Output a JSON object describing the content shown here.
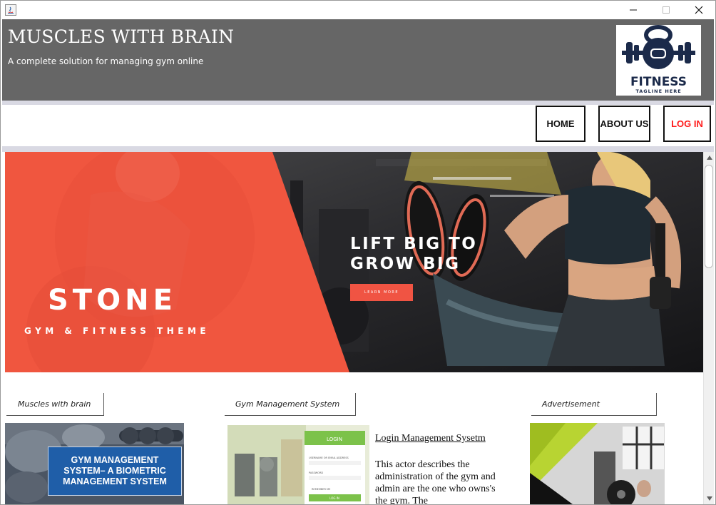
{
  "window": {
    "controls": {
      "minimize_icon": "minimize-icon",
      "maximize_icon": "maximize-icon",
      "close_icon": "close-icon"
    }
  },
  "header": {
    "title": "MUSCLES WITH BRAIN",
    "subtitle": "A complete solution for managing gym online",
    "logo": {
      "main_text": "FITNESS",
      "tagline": "TAGLINE HERE"
    },
    "background_color": "#666666"
  },
  "nav": {
    "home": "HOME",
    "about": "ABOUT US",
    "login": "LOG IN",
    "login_color": "#ff1a1a"
  },
  "hero": {
    "brand": "STONE",
    "tagline": "GYM & FITNESS THEME",
    "headline_line1": "LIFT BIG TO",
    "headline_line2": "GROW BIG",
    "cta": "LEARN MORE",
    "accent_color": "#f05443"
  },
  "sections": {
    "tab_1": "Muscles with brain",
    "tab_2": "Gym Management System",
    "tab_3": "Advertisement",
    "card_1_caption": "GYM MANAGEMENT SYSTEM– A BIOMETRIC MANAGEMENT SYSTEM",
    "login_heading": "Login Management Sysetm",
    "login_description": "This actor describes the administration of the gym and admin are the one who owns's the gym. The",
    "mockup_login_label": "LOGIN",
    "mockup_field_1": "USERNAME OR EMAIL ADDRESS",
    "mockup_field_2": "PASSWORD",
    "mockup_remember": "REMEMBER ME",
    "mockup_button": "LOG IN"
  },
  "scrollbar": {
    "up_icon": "scroll-up-icon",
    "down_icon": "scroll-down-icon"
  }
}
